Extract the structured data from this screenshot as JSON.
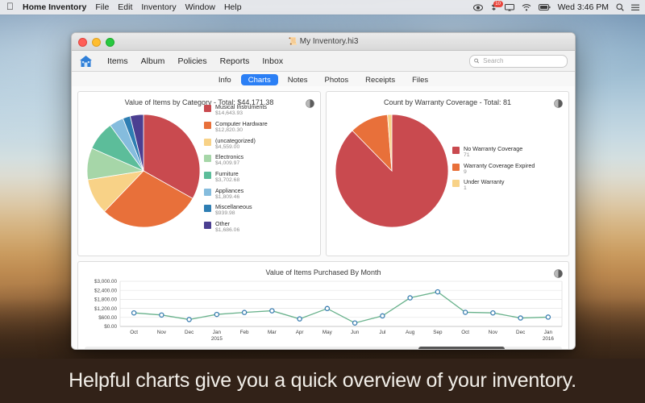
{
  "menubar": {
    "apple_glyph": "\u0010",
    "app_name": "Home Inventory",
    "items": [
      "File",
      "Edit",
      "Inventory",
      "Window",
      "Help"
    ],
    "status_icons": [
      "eye-icon",
      "dropbox-icon",
      "airplay-icon",
      "wifi-icon",
      "battery-icon"
    ],
    "notification_count": "10",
    "clock": "Wed 3:46 PM",
    "search_icon": "search-icon",
    "control_center_icon": "list-icon"
  },
  "window": {
    "title": "My Inventory.hi3",
    "doc_icon": "document-icon",
    "toolbar": {
      "home_icon": "home-icon",
      "items": [
        "Items",
        "Album",
        "Policies",
        "Reports",
        "Inbox"
      ],
      "search_placeholder": "Search",
      "search_value": ""
    },
    "tabs": [
      {
        "label": "Info",
        "active": false
      },
      {
        "label": "Charts",
        "active": true
      },
      {
        "label": "Notes",
        "active": false
      },
      {
        "label": "Photos",
        "active": false
      },
      {
        "label": "Receipts",
        "active": false
      },
      {
        "label": "Files",
        "active": false
      }
    ]
  },
  "caption": "Helpful charts give you a quick overview of your inventory.",
  "chart_data": [
    {
      "type": "pie",
      "title": "Value of Items by Category - Total: $44,171.38",
      "total": "$44,171.38",
      "legend_position": "right",
      "categories": [
        "Musical Instruments",
        "Computer Hardware",
        "(uncategorized)",
        "Electronics",
        "Furniture",
        "Appliances",
        "Miscellaneous",
        "Other"
      ],
      "values": [
        14643.93,
        12820.3,
        4559.0,
        4009.97,
        3702.68,
        1809.46,
        939.98,
        1686.06
      ],
      "value_labels": [
        "$14,643.93",
        "$12,820.30",
        "$4,559.00",
        "$4,009.97",
        "$3,702.68",
        "$1,809.46",
        "$939.98",
        "$1,686.06"
      ],
      "colors": [
        "#c94a4f",
        "#e8703a",
        "#f8d287",
        "#a6d6a8",
        "#5cbd9a",
        "#85bcdd",
        "#2e7eb3",
        "#4b3f91"
      ]
    },
    {
      "type": "pie",
      "title": "Count by Warranty Coverage - Total: 81",
      "total": "81",
      "legend_position": "right",
      "categories": [
        "No Warranty Coverage",
        "Warranty Coverage Expired",
        "Under Warranty"
      ],
      "values": [
        71,
        9,
        1
      ],
      "value_labels": [
        "71",
        "9",
        "1"
      ],
      "colors": [
        "#c94a4f",
        "#e8703a",
        "#f8d287"
      ]
    },
    {
      "type": "line",
      "title": "Value of Items Purchased By Month",
      "xlabel": "",
      "ylabel": "",
      "ylim": [
        0,
        3000
      ],
      "yticks": [
        0,
        600,
        1200,
        1800,
        2400,
        3000
      ],
      "ytick_labels": [
        "$0.00",
        "$600.00",
        "$1,200.00",
        "$1,800.00",
        "$2,400.00",
        "$3,000.00"
      ],
      "grid": true,
      "categories": [
        "Oct",
        "Nov",
        "Dec",
        "Jan\n2015",
        "Feb",
        "Mar",
        "Apr",
        "May",
        "Jun",
        "Jul",
        "Aug",
        "Sep",
        "Oct",
        "Nov",
        "Dec",
        "Jan\n2016"
      ],
      "x_labels": [
        "Oct",
        "Nov",
        "Dec",
        "Jan",
        "Feb",
        "Mar",
        "Apr",
        "May",
        "Jun",
        "Jul",
        "Aug",
        "Sep",
        "Oct",
        "Nov",
        "Dec",
        "Jan"
      ],
      "x_sublabels": [
        "",
        "",
        "",
        "2015",
        "",
        "",
        "",
        "",
        "",
        "",
        "",
        "",
        "",
        "",
        "",
        "2016"
      ],
      "values": [
        900,
        760,
        460,
        800,
        930,
        1040,
        500,
        1190,
        230,
        700,
        1900,
        2300,
        940,
        900,
        560,
        620
      ],
      "line_color": "#69b28c",
      "marker_color": "#3c7fb1"
    }
  ]
}
